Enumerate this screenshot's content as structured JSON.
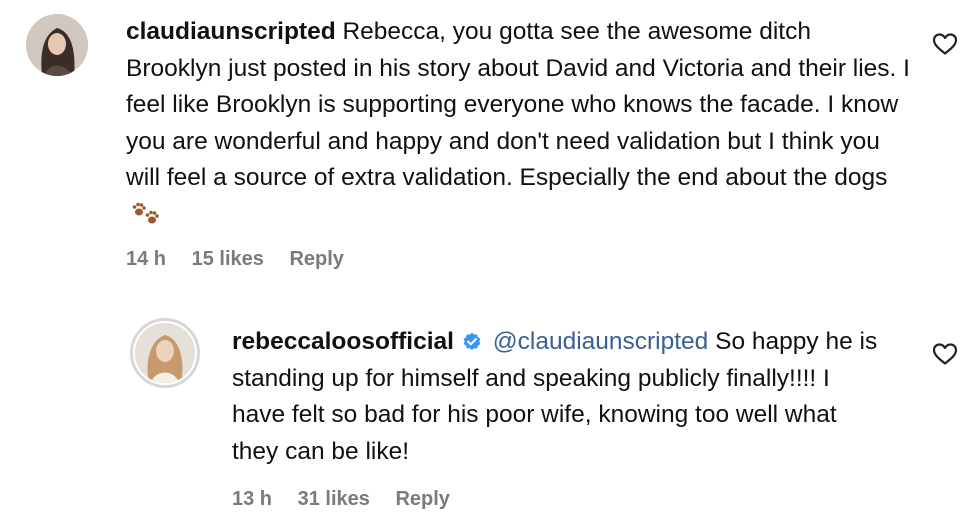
{
  "comments": [
    {
      "username": "claudiaunscripted",
      "text": "Rebecca, you gotta see the awesome ditch Brooklyn just posted in his story about David and Victoria and their lies. I feel like Brooklyn is supporting everyone who knows the facade. I know you are wonderful and happy and don't need validation but I think you will feel a source of extra validation. Especially the end about the dogs",
      "emoji": "paw-prints",
      "time": "14 h",
      "likes": "15 likes",
      "reply_label": "Reply",
      "avatar": "profile-photo"
    },
    {
      "username": "rebeccaloosofficial",
      "verified": true,
      "mention": "@claudiaunscripted",
      "text": "So happy he is standing up for himself and speaking publicly finally!!!! I have felt so bad for his poor wife, knowing too well what they can be like!",
      "time": "13 h",
      "likes": "31 likes",
      "reply_label": "Reply",
      "avatar": "profile-photo"
    }
  ],
  "colors": {
    "text": "#111111",
    "meta": "#7b7b7b",
    "mention": "#3a5f95",
    "verified": "#3897f0"
  },
  "icons": [
    "heart-icon",
    "verified-badge-icon",
    "paw-prints-emoji"
  ]
}
